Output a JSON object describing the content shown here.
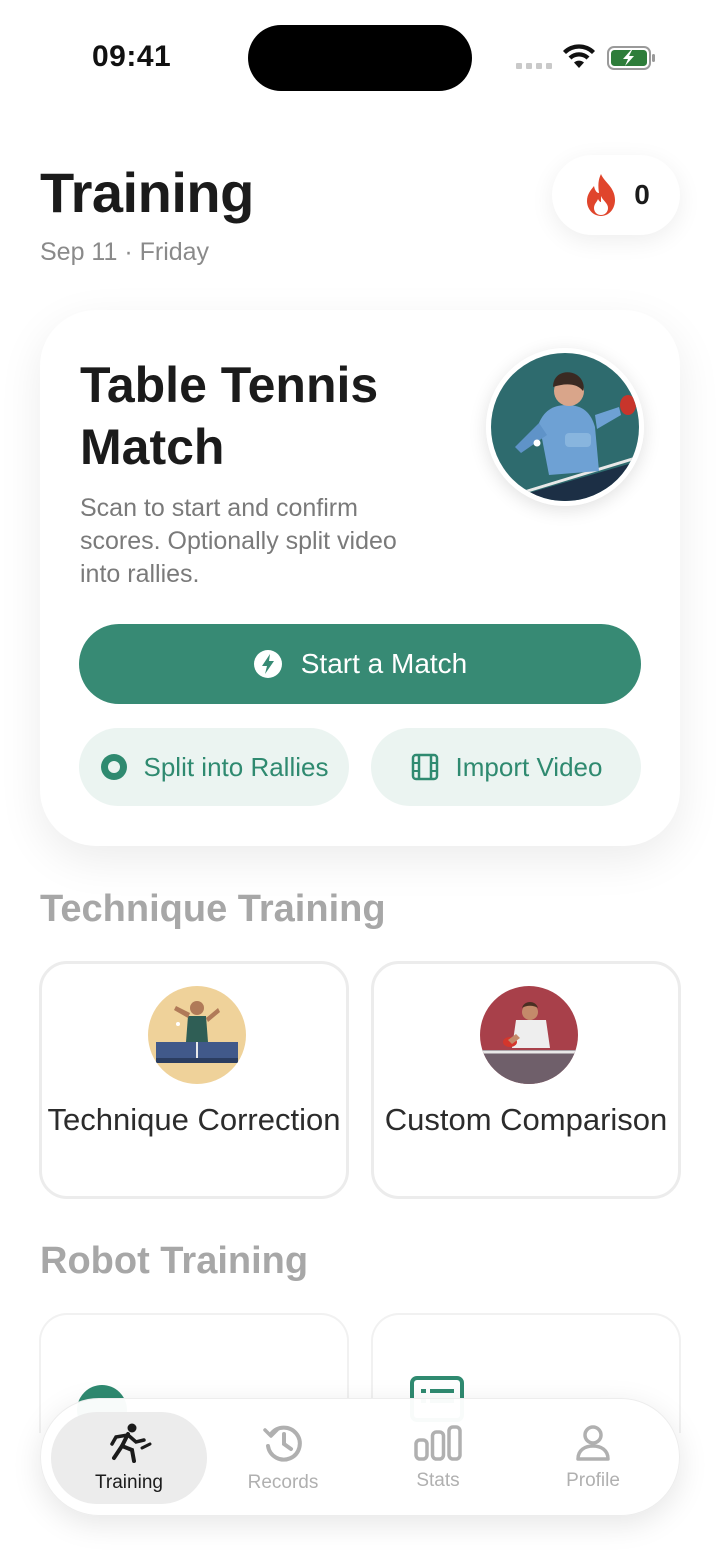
{
  "status_bar": {
    "time": "09:41"
  },
  "header": {
    "title": "Training",
    "date": "Sep 11 · Friday",
    "streak_count": "0"
  },
  "match_card": {
    "title": "Table Tennis Match",
    "description": "Scan to start and confirm scores. Optionally split video into rallies.",
    "start_button": "Start a Match",
    "split_button": "Split into Rallies",
    "import_button": "Import Video"
  },
  "technique": {
    "section_title": "Technique Training",
    "tiles": [
      {
        "label": "Technique Correction"
      },
      {
        "label": "Custom Comparison"
      }
    ]
  },
  "robot": {
    "section_title": "Robot Training"
  },
  "tab_bar": {
    "active": "Training",
    "tabs": [
      {
        "label": "Training",
        "icon": "running-figure-icon"
      },
      {
        "label": "Records",
        "icon": "history-icon"
      },
      {
        "label": "Stats",
        "icon": "bar-chart-icon"
      },
      {
        "label": "Profile",
        "icon": "person-icon"
      }
    ]
  },
  "colors": {
    "accent": "#378a74",
    "accent_soft": "#ebf4f1",
    "flame": "#e0452c"
  }
}
